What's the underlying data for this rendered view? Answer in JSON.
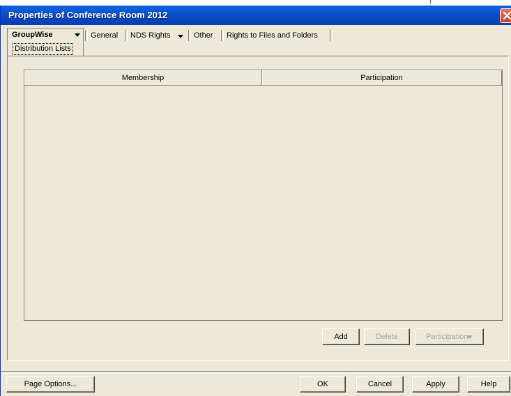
{
  "window": {
    "title": "Properties of Conference Room 2012"
  },
  "tabs": {
    "active": {
      "label": "GroupWise",
      "sub_label": "Distribution Lists"
    },
    "items": [
      {
        "label": "General"
      },
      {
        "label": "NDS Rights"
      },
      {
        "label": "Other"
      },
      {
        "label": "Rights to Files and Folders"
      }
    ]
  },
  "table": {
    "columns": [
      "Membership",
      "Participation"
    ],
    "rows": []
  },
  "actions": {
    "add_label": "Add",
    "delete_label": "Delete",
    "participation_label": "Participation"
  },
  "footer": {
    "page_options_label": "Page Options...",
    "ok_label": "OK",
    "cancel_label": "Cancel",
    "apply_label": "Apply",
    "help_label": "Help"
  },
  "icons": {
    "close": "close-icon",
    "dropdown": "chevron-down-icon"
  },
  "colors": {
    "titlebar": "#0a50c6",
    "window_bg": "#ece9d8",
    "close_button": "#d2532d",
    "disabled_text": "#aca899"
  }
}
